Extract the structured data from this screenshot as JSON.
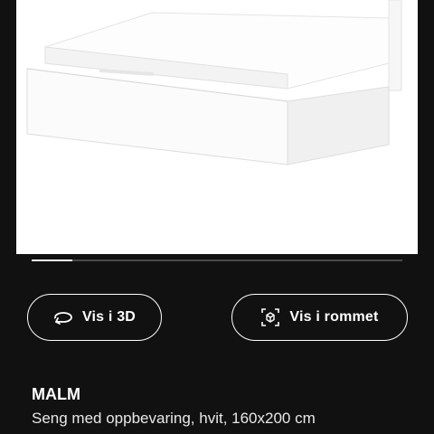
{
  "product_image": {
    "alt": "MALM bed frame"
  },
  "carousel": {
    "progress": 0.11
  },
  "actions": {
    "view_3d_label": "Vis i 3D",
    "view_in_room_label": "Vis i rommet",
    "view_3d_icon": "rotate-3d-icon",
    "view_in_room_icon": "ar-cube-icon"
  },
  "product": {
    "name": "MALM",
    "description": "Seng med oppbevaring, hvit, 160x200 cm"
  },
  "colors": {
    "background": "#111111",
    "foreground": "#ffffff"
  }
}
